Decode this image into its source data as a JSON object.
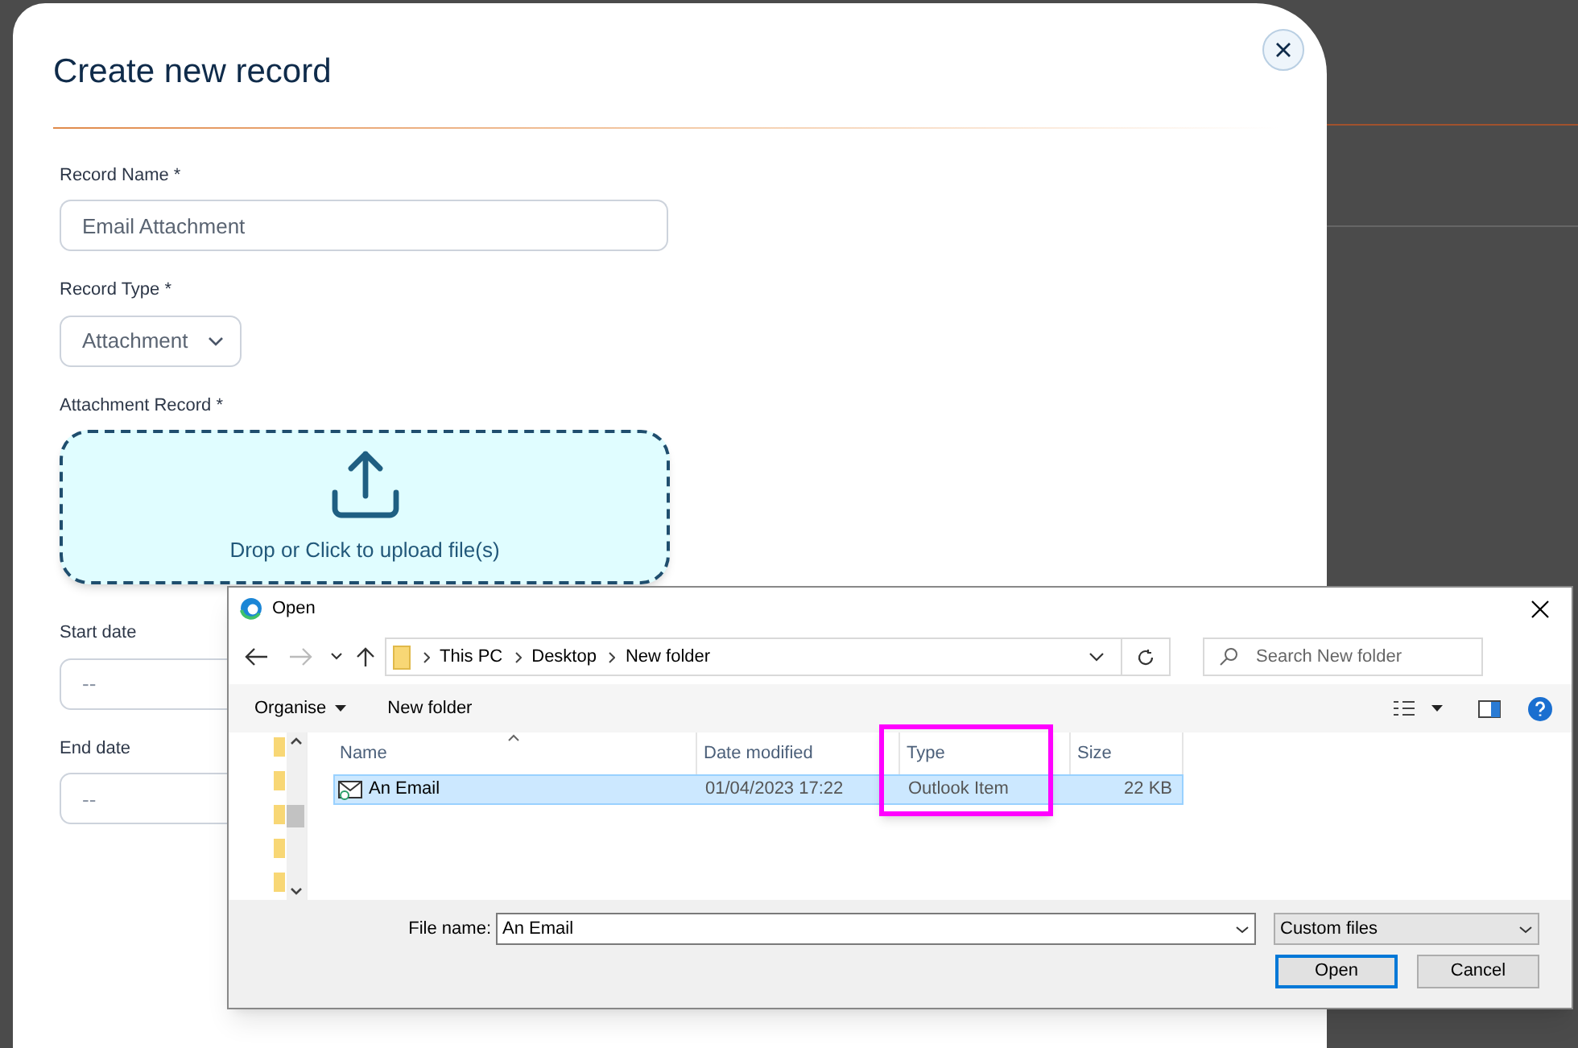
{
  "modal": {
    "title": "Create new record",
    "fields": [
      {
        "kind": "text",
        "label": "Record Name *",
        "value": "Email Attachment"
      },
      {
        "kind": "select",
        "label": "Record Type *",
        "value": "Attachment"
      },
      {
        "kind": "upload",
        "label": "Attachment Record *",
        "text": "Drop or Click to upload file(s)"
      },
      {
        "kind": "date",
        "label": "Start date",
        "placeholder": "--"
      },
      {
        "kind": "date",
        "label": "End date",
        "placeholder": "--"
      }
    ]
  },
  "dialog": {
    "title": "Open",
    "path": [
      "This PC",
      "Desktop",
      "New folder"
    ],
    "search": {
      "placeholder": "Search New folder"
    },
    "toolbar": {
      "organise": "Organise",
      "new_folder": "New folder"
    },
    "columns": [
      {
        "label": "Name",
        "highlighted": false
      },
      {
        "label": "Date modified",
        "highlighted": false
      },
      {
        "label": "Type",
        "highlighted": true
      },
      {
        "label": "Size",
        "highlighted": false
      }
    ],
    "files": [
      {
        "name": "An Email",
        "date": "01/04/2023 17:22",
        "type": "Outlook Item",
        "size": "22 KB",
        "selected": true
      }
    ],
    "file_name_label": "File name:",
    "file_name": "An Email",
    "filter": "Custom files",
    "buttons": [
      {
        "label": "Open",
        "kind": "primary"
      },
      {
        "label": "Cancel",
        "kind": "secondary"
      }
    ]
  }
}
